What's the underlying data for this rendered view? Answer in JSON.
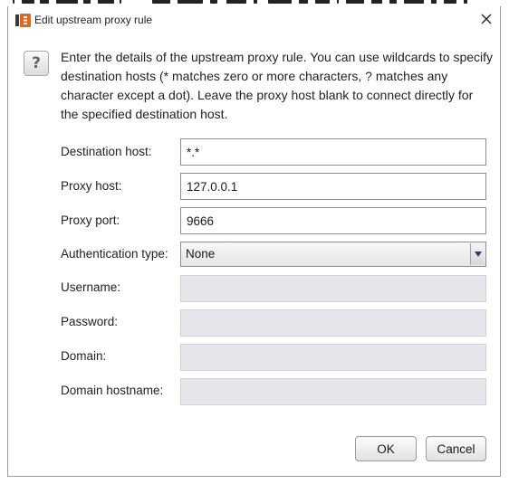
{
  "window": {
    "title": "Edit upstream proxy rule"
  },
  "description": "Enter the details of the upstream proxy rule. You can use wildcards to specify destination hosts (* matches zero or more characters, ? matches any character except a dot). Leave the proxy host blank to connect directly for the specified destination host.",
  "form": {
    "destination_host": {
      "label": "Destination host:",
      "value": "*.*"
    },
    "proxy_host": {
      "label": "Proxy host:",
      "value": "127.0.0.1"
    },
    "proxy_port": {
      "label": "Proxy port:",
      "value": "9666"
    },
    "authentication_type": {
      "label": "Authentication type:",
      "value": "None"
    },
    "username": {
      "label": "Username:",
      "value": ""
    },
    "password": {
      "label": "Password:",
      "value": ""
    },
    "domain": {
      "label": "Domain:",
      "value": ""
    },
    "domain_hostname": {
      "label": "Domain hostname:",
      "value": ""
    }
  },
  "buttons": {
    "ok": "OK",
    "cancel": "Cancel"
  },
  "icons": {
    "app": "burp-logo-icon",
    "close": "close-icon",
    "help": "question-mark-icon",
    "dropdown": "chevron-down-icon"
  },
  "colors": {
    "app_icon_orange": "#e8631c",
    "disabled_field": "#e5e6ea",
    "field_border": "#8c8c8c"
  }
}
